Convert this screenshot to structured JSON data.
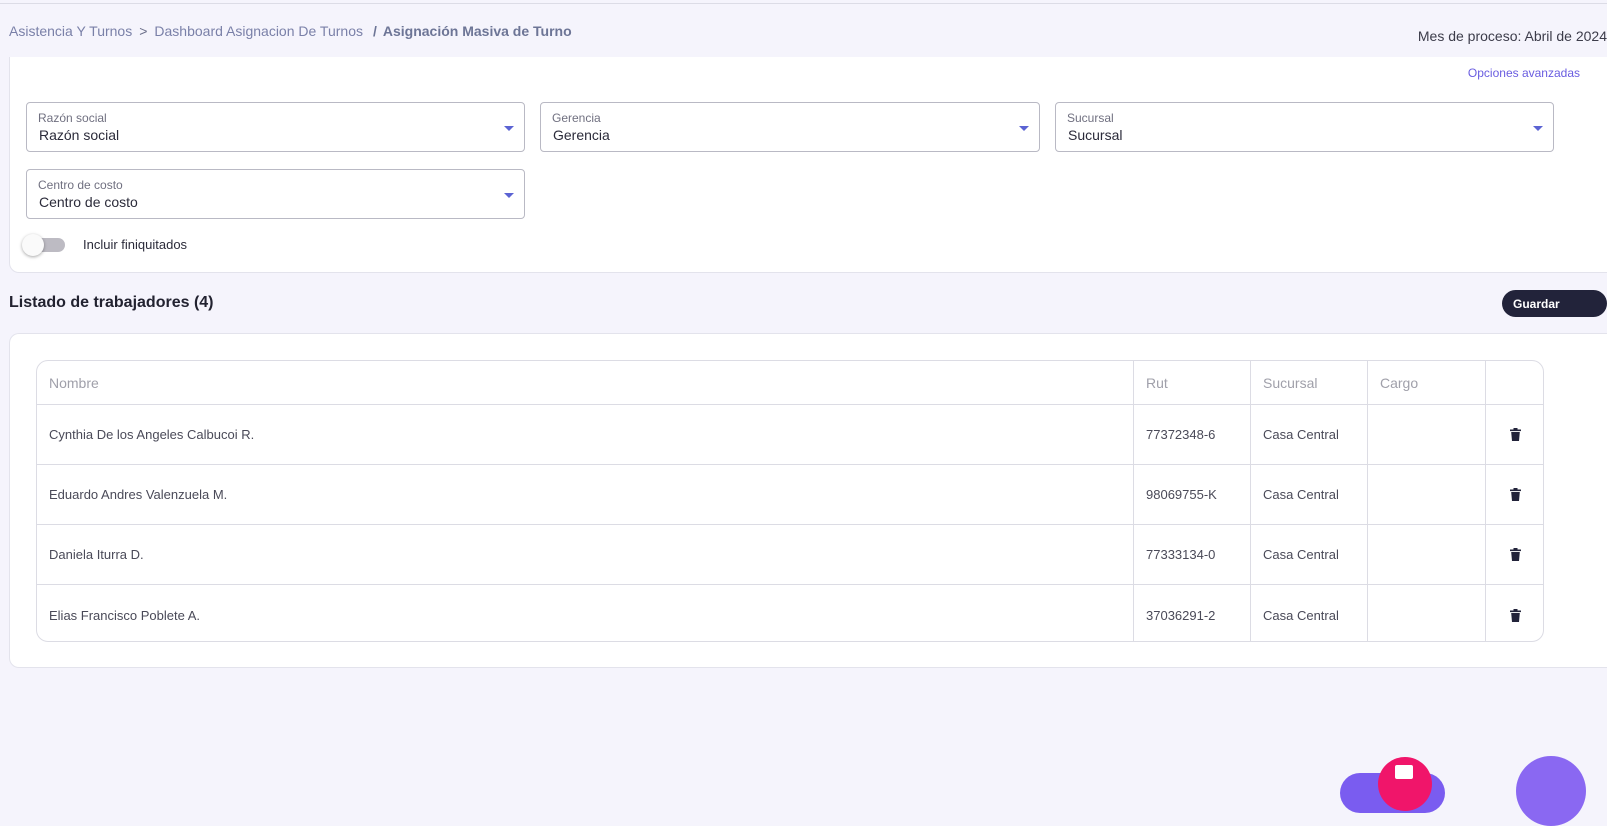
{
  "breadcrumb": {
    "item1": "Asistencia Y Turnos",
    "sep1": ">",
    "item2": "Dashboard Asignacion De Turnos",
    "sep2": "/",
    "current": "Asignación Masiva de Turno"
  },
  "process_month": "Mes de proceso: Abril de 2024",
  "filters": {
    "advanced_options": "Opciones avanzadas",
    "razon_social": {
      "label": "Razón social",
      "value": "Razón social"
    },
    "gerencia": {
      "label": "Gerencia",
      "value": "Gerencia"
    },
    "sucursal": {
      "label": "Sucursal",
      "value": "Sucursal"
    },
    "centro_costo": {
      "label": "Centro de costo",
      "value": "Centro de costo"
    },
    "include_finiquitados": {
      "label": "Incluir finiquitados",
      "on": false
    }
  },
  "list": {
    "title": "Listado de trabajadores (4)",
    "save_label": "Guardar",
    "columns": [
      "Nombre",
      "Rut",
      "Sucursal",
      "Cargo",
      ""
    ],
    "rows": [
      {
        "nombre": "Cynthia De los Angeles Calbucoi R.",
        "rut": "77372348-6",
        "sucursal": "Casa Central",
        "cargo": ""
      },
      {
        "nombre": "Eduardo Andres Valenzuela M.",
        "rut": "98069755-K",
        "sucursal": "Casa Central",
        "cargo": ""
      },
      {
        "nombre": "Daniela Iturra D.",
        "rut": "77333134-0",
        "sucursal": "Casa Central",
        "cargo": ""
      },
      {
        "nombre": "Elias Francisco Poblete A.",
        "rut": "37036291-2",
        "sucursal": "Casa Central",
        "cargo": ""
      }
    ]
  },
  "icons": {
    "delete": "trash-icon",
    "dropdown": "caret-down-icon",
    "fab": "clipboard-icon"
  },
  "colors": {
    "accent": "#5b63d3",
    "primary_button": "#22233a",
    "link": "#6a5de0",
    "fab_pink": "#f0156a",
    "fab_purple": "#8a68f2"
  }
}
